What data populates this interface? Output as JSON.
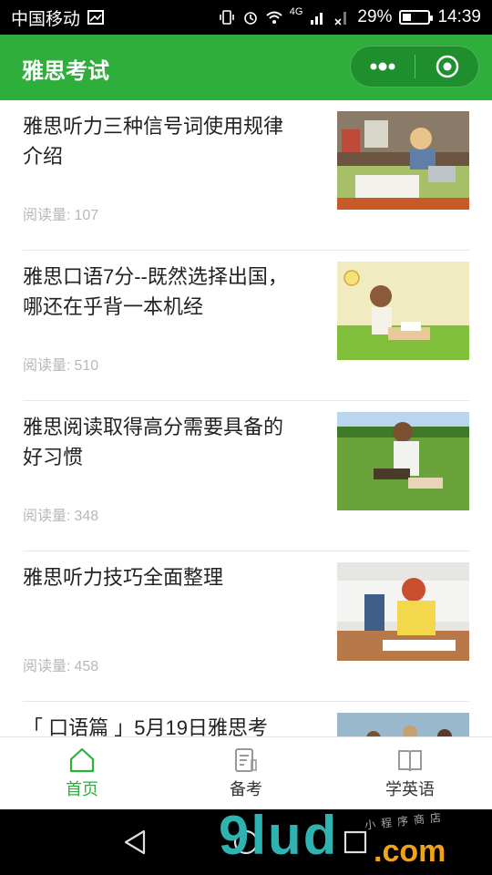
{
  "status_bar": {
    "carrier": "中国移动",
    "battery_percent": "29%",
    "time": "14:39",
    "network": "4G"
  },
  "header": {
    "title": "雅思考试",
    "accent": "#2eaf3c"
  },
  "articles": [
    {
      "title": "雅思听力三种信号词使用规律介绍",
      "reads_label": "阅读量:",
      "reads": "107",
      "image": "woman-studying-on-bed"
    },
    {
      "title": "雅思口语7分--既然选择出国，哪还在乎背一本机经",
      "reads_label": "阅读量:",
      "reads": "510",
      "image": "woman-reading-in-field-lightbulb"
    },
    {
      "title": "雅思阅读取得高分需要具备的好习惯",
      "reads_label": "阅读量:",
      "reads": "348",
      "image": "woman-with-tablet-in-grass"
    },
    {
      "title": "雅思听力技巧全面整理",
      "reads_label": "阅读量:",
      "reads": "458",
      "image": "woman-with-glasses-reading-on-floor"
    },
    {
      "title": "「 口语篇 」5月19日雅思考",
      "reads_label": "",
      "reads": "",
      "image": "students-group"
    }
  ],
  "tabs": [
    {
      "label": "首页",
      "icon": "home-icon",
      "active": true
    },
    {
      "label": "备考",
      "icon": "notes-icon",
      "active": false
    },
    {
      "label": "学英语",
      "icon": "book-icon",
      "active": false
    }
  ],
  "watermark": {
    "main": "9lud",
    "suffix": ".com",
    "sub": "小程序商店"
  }
}
